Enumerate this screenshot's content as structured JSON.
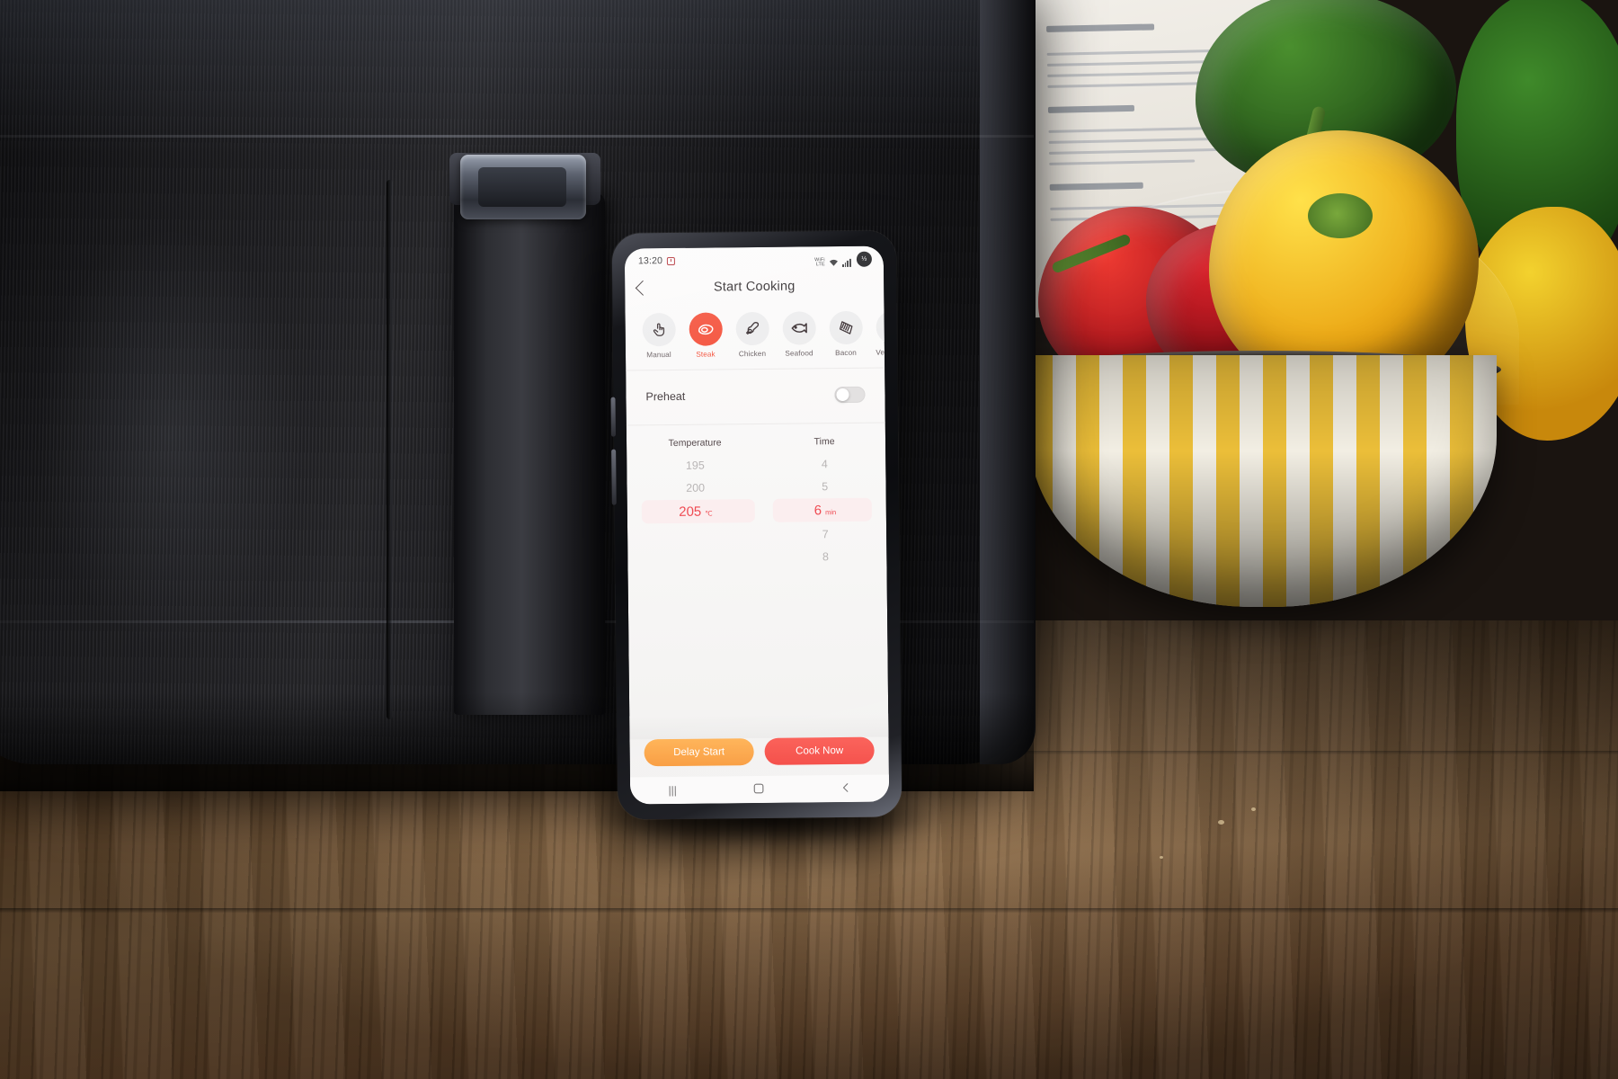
{
  "scene": {
    "description": "Smartphone propped against a black air fryer on a wooden kitchen counter, bowl of bell peppers at right",
    "colors": {
      "accent_red": "#f4523c",
      "accent_red_text": "#ef4a52",
      "selected_pill": "#fbeeef",
      "delay_button": "#f99a3b",
      "cook_button": "#f4453f",
      "screen_bg": "#faf9f8",
      "mode_circle": "#ededee",
      "muted_text": "#b9b6b6"
    }
  },
  "phone": {
    "statusbar": {
      "time": "13:20",
      "alarm_icon": "alarm-clock-icon",
      "wifi_label": "WiFi",
      "signal_label": "LTE",
      "signal_icon": "signal-bars-icon",
      "wifi_icon": "wifi-icon",
      "battery_icon": "battery-circle-icon",
      "battery_text": "⅓"
    },
    "appbar": {
      "back_icon": "chevron-left-icon",
      "title": "Start Cooking"
    },
    "modes": [
      {
        "label": "Manual",
        "icon": "hand-tap-icon",
        "active": false
      },
      {
        "label": "Steak",
        "icon": "steak-icon",
        "active": true
      },
      {
        "label": "Chicken",
        "icon": "drumstick-icon",
        "active": false
      },
      {
        "label": "Seafood",
        "icon": "fish-icon",
        "active": false
      },
      {
        "label": "Bacon",
        "icon": "bacon-icon",
        "active": false
      },
      {
        "label": "Vegetable",
        "icon": "vegetable-icon",
        "active": false
      }
    ],
    "preheat": {
      "label": "Preheat",
      "toggle_state": "off"
    },
    "pickers": {
      "temperature": {
        "header": "Temperature",
        "unit": "℃",
        "options": [
          "195",
          "200",
          "205",
          "",
          ""
        ],
        "selected": "205"
      },
      "time": {
        "header": "Time",
        "unit": "min",
        "options": [
          "4",
          "5",
          "6",
          "7",
          "8"
        ],
        "selected": "6"
      }
    },
    "actions": {
      "delay_start": "Delay Start",
      "cook_now": "Cook Now"
    },
    "navbar": {
      "recents": "|||",
      "home": "home-square-icon",
      "back": "back-chevron-icon"
    }
  }
}
